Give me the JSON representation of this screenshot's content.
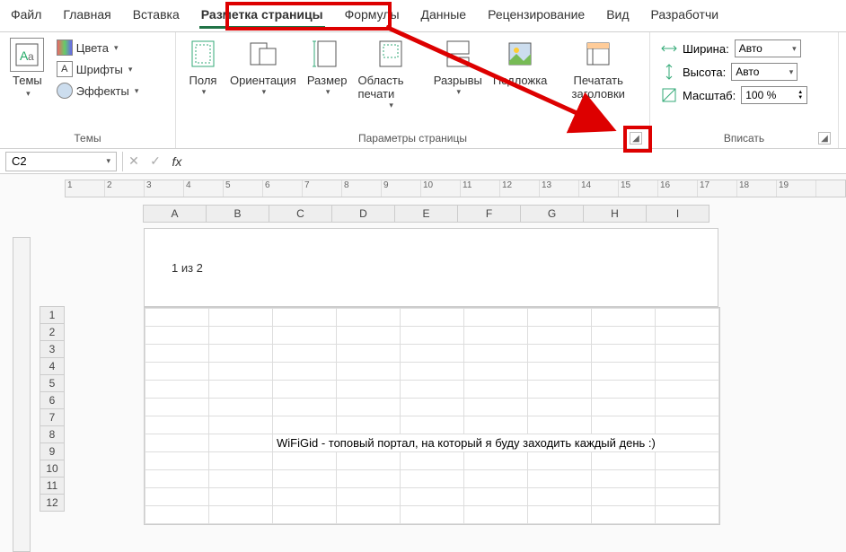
{
  "tabs": {
    "file": "Файл",
    "home": "Главная",
    "insert": "Вставка",
    "page_layout": "Разметка страницы",
    "formulas": "Формулы",
    "data": "Данные",
    "review": "Рецензирование",
    "view": "Вид",
    "developer": "Разработчи"
  },
  "ribbon": {
    "themes": {
      "label": "Темы",
      "themes_btn": "Темы",
      "colors": "Цвета",
      "fonts": "Шрифты",
      "effects": "Эффекты"
    },
    "page_setup": {
      "label": "Параметры страницы",
      "margins": "Поля",
      "orientation": "Ориентация",
      "size": "Размер",
      "print_area": "Область печати",
      "breaks": "Разрывы",
      "background": "Подложка",
      "print_titles": "Печатать заголовки"
    },
    "fit": {
      "label": "Вписать",
      "width_label": "Ширина:",
      "width_value": "Авто",
      "height_label": "Высота:",
      "height_value": "Авто",
      "scale_label": "Масштаб:",
      "scale_value": "100 %"
    }
  },
  "formula_bar": {
    "cell_ref": "C2",
    "fx": "fx",
    "value": ""
  },
  "sheet": {
    "ruler_ticks": [
      "1",
      "2",
      "3",
      "4",
      "5",
      "6",
      "7",
      "8",
      "9",
      "10",
      "11",
      "12",
      "13",
      "14",
      "15",
      "16",
      "17",
      "18",
      "19"
    ],
    "columns": [
      "A",
      "B",
      "C",
      "D",
      "E",
      "F",
      "G",
      "H",
      "I"
    ],
    "rows": [
      "1",
      "2",
      "3",
      "4",
      "5",
      "6",
      "7",
      "8",
      "9",
      "10",
      "11",
      "12"
    ],
    "header_text": "1 из 2",
    "cell_c8": "WiFiGid - топовый портал, на который я буду заходить каждый день :)"
  }
}
